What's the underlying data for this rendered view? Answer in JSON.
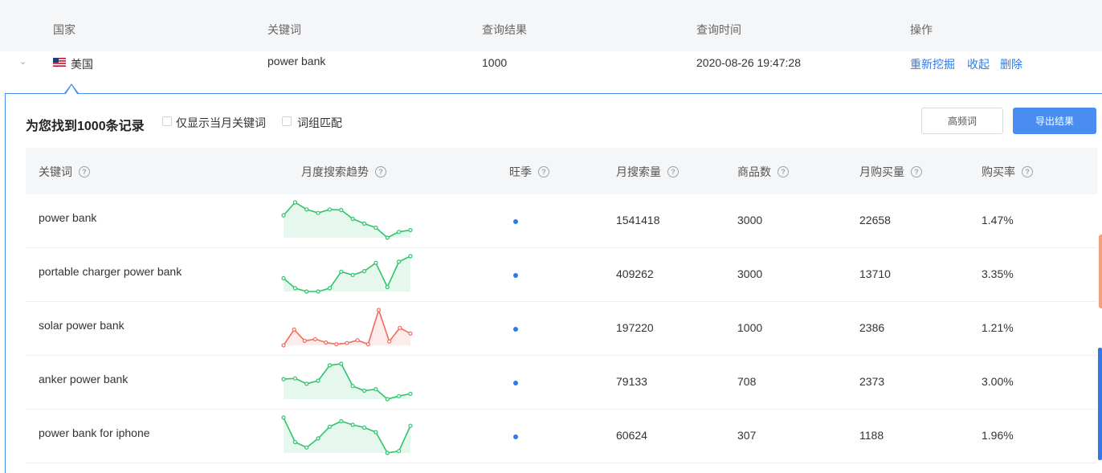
{
  "outer_table": {
    "headers": [
      "国家",
      "关键词",
      "查询结果",
      "查询时间",
      "操作"
    ],
    "row": {
      "country": "美国",
      "keyword": "power bank",
      "result": "1000",
      "time": "2020-08-26 19:47:28",
      "actions": [
        "重新挖掘",
        "收起",
        "删除"
      ]
    }
  },
  "panel": {
    "found_text": "为您找到1000条记录",
    "filters": [
      "仅显示当月关键词",
      "词组匹配"
    ],
    "buttons": {
      "high_freq": "高频词",
      "export": "导出结果"
    }
  },
  "inner_table": {
    "headers": [
      "关键词",
      "月度搜索趋势",
      "旺季",
      "月搜索量",
      "商品数",
      "月购买量",
      "购买率"
    ],
    "help_glyph": "?",
    "rows": [
      {
        "keyword": "power bank",
        "trend": [
          20,
          42,
          30,
          24,
          30,
          29,
          14,
          6,
          -1,
          -18,
          -8,
          -5
        ],
        "trend_color": "green",
        "search_volume": "1541418",
        "products": "3000",
        "purchases": "22658",
        "rate": "1.47%"
      },
      {
        "keyword": "portable charger power bank",
        "trend": [
          8,
          -10,
          -16,
          -16,
          -10,
          20,
          14,
          21,
          36,
          -8,
          38,
          48
        ],
        "trend_color": "green",
        "search_volume": "409262",
        "products": "3000",
        "purchases": "13710",
        "rate": "3.35%"
      },
      {
        "keyword": "solar power bank",
        "trend": [
          0,
          28,
          8,
          11,
          5,
          2,
          4,
          9,
          2,
          63,
          7,
          31,
          21
        ],
        "trend_color": "red",
        "search_volume": "197220",
        "products": "1000",
        "purchases": "2386",
        "rate": "1.21%"
      },
      {
        "keyword": "anker power bank",
        "trend": [
          20,
          21,
          14,
          18,
          38,
          40,
          11,
          5,
          7,
          -6,
          -2,
          1
        ],
        "trend_color": "green",
        "search_volume": "79133",
        "products": "708",
        "purchases": "2373",
        "rate": "3.00%"
      },
      {
        "keyword": "power bank for iphone",
        "trend": [
          30,
          3,
          -3,
          7,
          20,
          26,
          22,
          19,
          14,
          -9,
          -7,
          21
        ],
        "trend_color": "green",
        "search_volume": "60624",
        "products": "307",
        "purchases": "1188",
        "rate": "1.96%"
      }
    ]
  },
  "colors": {
    "accent": "#4a8df0",
    "link": "#2f7ae5",
    "trend_green": "#2ec56b",
    "trend_green_fill": "#e6f7ed",
    "trend_red": "#f26b5b",
    "trend_red_fill": "#fdeceb"
  },
  "icons": {
    "expand": "chevron-down-icon",
    "flag": "us-flag-icon",
    "help": "help-circle-icon",
    "peak": "dot-icon"
  }
}
